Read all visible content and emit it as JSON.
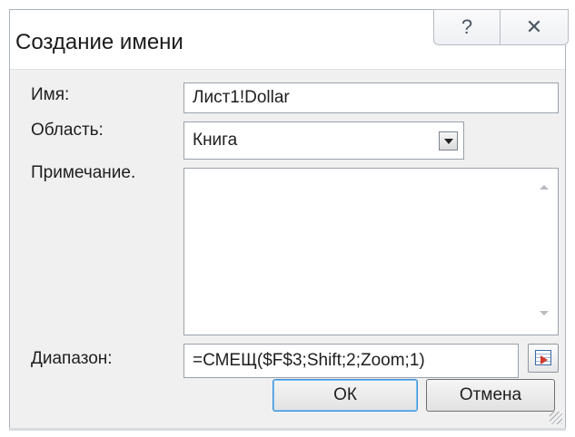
{
  "window": {
    "title": "Создание имени"
  },
  "titlebar": {
    "help_glyph": "?",
    "close_glyph": "✕"
  },
  "form": {
    "name_label": "Имя:",
    "name_value": "Лист1!Dollar",
    "scope_label": "Область:",
    "scope_value": "Книга",
    "comment_label": "Примечание.",
    "comment_value": "",
    "range_label": "Диапазон:",
    "range_value": "=СМЕЩ($F$3;Shift;2;Zoom;1)"
  },
  "buttons": {
    "ok_label": "ОК",
    "cancel_label": "Отмена"
  }
}
